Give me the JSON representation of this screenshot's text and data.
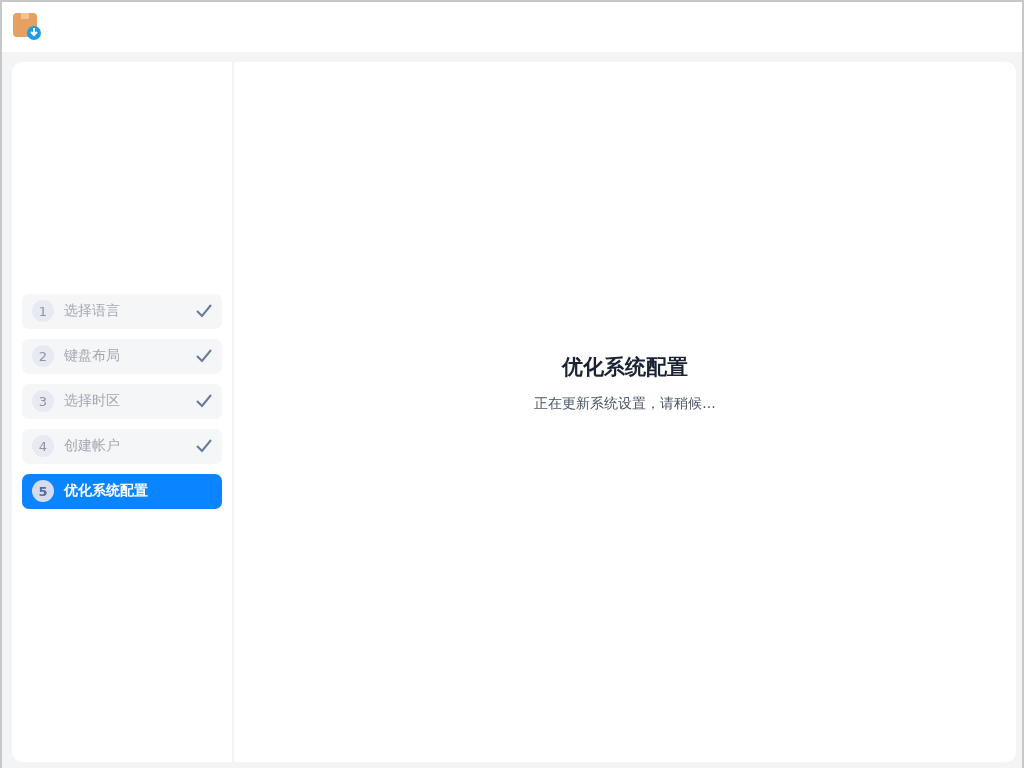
{
  "steps": [
    {
      "number": "1",
      "label": "选择语言",
      "done": true,
      "selected": false
    },
    {
      "number": "2",
      "label": "键盘布局",
      "done": true,
      "selected": false
    },
    {
      "number": "3",
      "label": "选择时区",
      "done": true,
      "selected": false
    },
    {
      "number": "4",
      "label": "创建帐户",
      "done": true,
      "selected": false
    },
    {
      "number": "5",
      "label": "优化系统配置",
      "done": false,
      "selected": true
    }
  ],
  "content": {
    "title": "优化系统配置",
    "message": "正在更新系统设置，请稍候..."
  }
}
